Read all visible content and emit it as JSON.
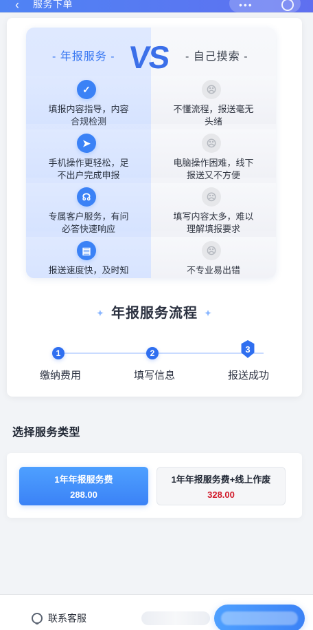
{
  "topbar": {
    "title": "服务下单"
  },
  "compare": {
    "left_title": "- 年报服务 -",
    "vs": "VS",
    "right_title": "- 自己摸索 -",
    "left_items": [
      {
        "icon": "check-icon",
        "text": "填报内容指导，内容\n合规检测"
      },
      {
        "icon": "send-icon",
        "text": "手机操作更轻松，足\n不出户完成申报"
      },
      {
        "icon": "service-icon",
        "text": "专属客户服务，有问\n必答快速响应"
      },
      {
        "icon": "doc-icon",
        "text": "报送速度快，及时知\n晓报送结果"
      }
    ],
    "right_items": [
      {
        "icon": "sad-face-icon",
        "text": "不懂流程，报送毫无\n头绪"
      },
      {
        "icon": "sad-face-icon",
        "text": "电脑操作困难，线下\n报送又不方便"
      },
      {
        "icon": "sad-face-icon",
        "text": "填写内容太多，难以\n理解填报要求"
      },
      {
        "icon": "sad-face-icon",
        "text": "不专业易出错"
      }
    ]
  },
  "flow": {
    "title": "年报服务流程",
    "steps": [
      {
        "num": "1",
        "label": "缴纳费用"
      },
      {
        "num": "2",
        "label": "填写信息"
      },
      {
        "num": "3",
        "label": "报送成功"
      }
    ]
  },
  "service_type": {
    "title": "选择服务类型",
    "options": [
      {
        "label": "1年年报服务费",
        "price": "288.00",
        "selected": true
      },
      {
        "label": "1年年报服务费+线上作废",
        "price": "328.00",
        "selected": false
      }
    ]
  },
  "bottom": {
    "contact_label": "联系客服"
  },
  "colors": {
    "accent": "#3b82f6",
    "price_red": "#d11a2a"
  }
}
